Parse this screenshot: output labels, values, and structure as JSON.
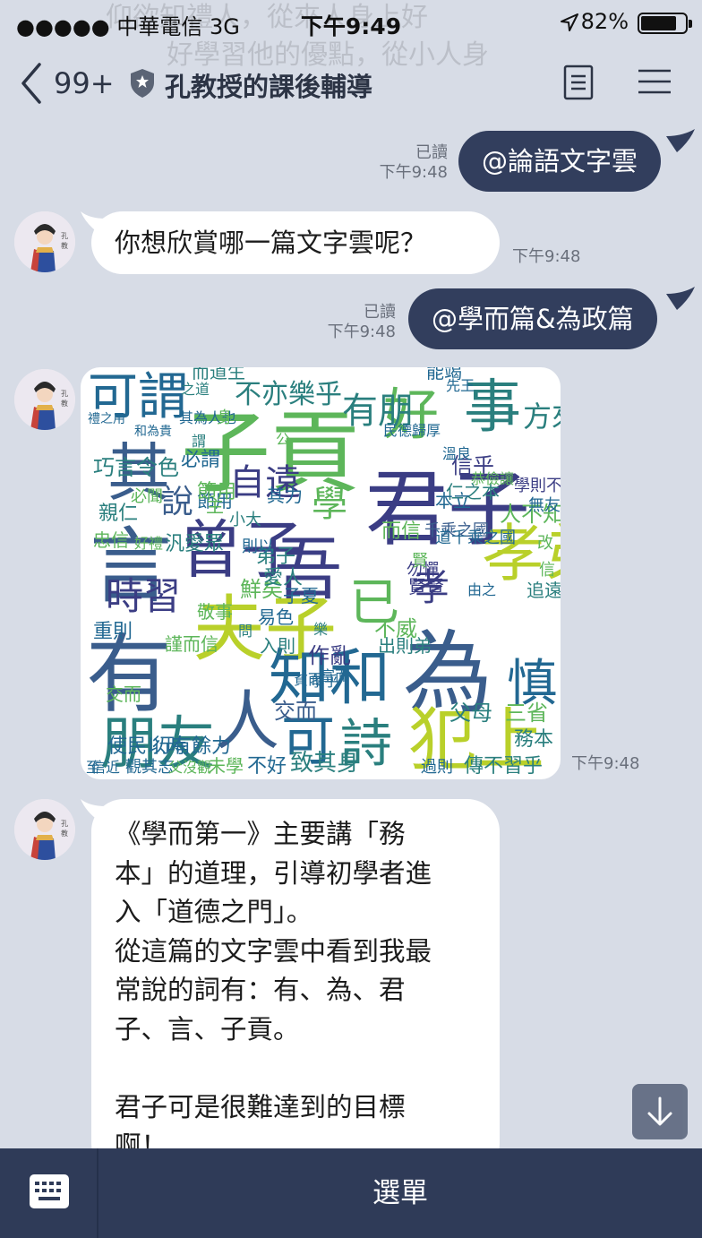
{
  "status_bar": {
    "carrier": "●●●●● 中華電信   3G",
    "time": "下午9:49",
    "battery": "82%",
    "battery_level": 0.82
  },
  "background_ghost_text": [
    "仰欲知禮人，從來人身上好",
    "好學習他的優點，從小人身"
  ],
  "header": {
    "unread_count": "99+",
    "title": "孔教授的課後輔導",
    "icons": [
      "back-chevron-icon",
      "shield-icon",
      "note-icon",
      "hamburger-menu-icon"
    ]
  },
  "messages": [
    {
      "direction": "out",
      "text": "@論語文字雲",
      "read": "已讀",
      "time": "下午9:48"
    },
    {
      "direction": "in",
      "text": "你想欣賞哪一篇文字雲呢？",
      "time": "下午9:48"
    },
    {
      "direction": "out",
      "text": "@學而篇&為政篇",
      "read": "已讀",
      "time": "下午9:48"
    },
    {
      "direction": "in",
      "type": "image",
      "alt": "word-cloud",
      "time": "下午9:48"
    },
    {
      "direction": "in",
      "text": "《學而第一》主要講「務\n本」的道理，引導初學者進\n入「道德之門」。\n從這篇的文字雲中看到我最\n常說的詞有：有、為、君\n子、言、子貢。\n\n君子可是很難達到的目標\n啊！\n沒想到我的弟子「子貢」"
    }
  ],
  "avatar_caption": "孔教授",
  "word_cloud": {
    "colors": [
      "#3b3d84",
      "#2a7f7e",
      "#5db65a",
      "#b9d02a",
      "#226892",
      "#3a5d8c"
    ],
    "words": [
      "君子",
      "有",
      "為",
      "言",
      "子貢",
      "其",
      "吾",
      "曾子",
      "夫子",
      "可謂",
      "事",
      "好",
      "孝弟",
      "犯上",
      "知和",
      "朋友",
      "詩",
      "人",
      "慎",
      "已",
      "學",
      "自遠",
      "孝",
      "不亦樂乎",
      "有朋",
      "方來",
      "時習",
      "說",
      "鮮矣",
      "務本",
      "可",
      "入則",
      "出則弟",
      "三省",
      "千乘之國",
      "父母",
      "傳不習乎",
      "交而",
      "禮之用",
      "和為貴",
      "仁之本",
      "民德歸厚",
      "能竭",
      "信乎",
      "學則不固",
      "人不知",
      "追遠",
      "使民以時",
      "行有餘力",
      "巧言令色",
      "親仁",
      "節用",
      "而信",
      "弟子",
      "愛人",
      "子夏",
      "易色",
      "作亂",
      "不威",
      "重則",
      "謹而信",
      "敬事",
      "道千乘之國",
      "致其身",
      "不好",
      "未學",
      "交而",
      "無友",
      "改",
      "信",
      "忠信",
      "汎愛眾",
      "過則",
      "觀其志",
      "父沒觀",
      "信近",
      "至",
      "貧而",
      "樂",
      "富而",
      "好禮",
      "謂",
      "其為人也",
      "孝乎",
      "主",
      "本立",
      "而道生",
      "賢賢",
      "公",
      "問",
      "勿憚",
      "則以",
      "其力",
      "必聞",
      "節用",
      "必謂",
      "身",
      "賢",
      "先王",
      "溫良",
      "恭儉讓",
      "之道",
      "小大",
      "由之"
    ]
  },
  "scroll_down_icon": "arrow-down-icon",
  "bottom_bar": {
    "keyboard_icon": "keyboard-icon",
    "menu_label": "選單"
  }
}
